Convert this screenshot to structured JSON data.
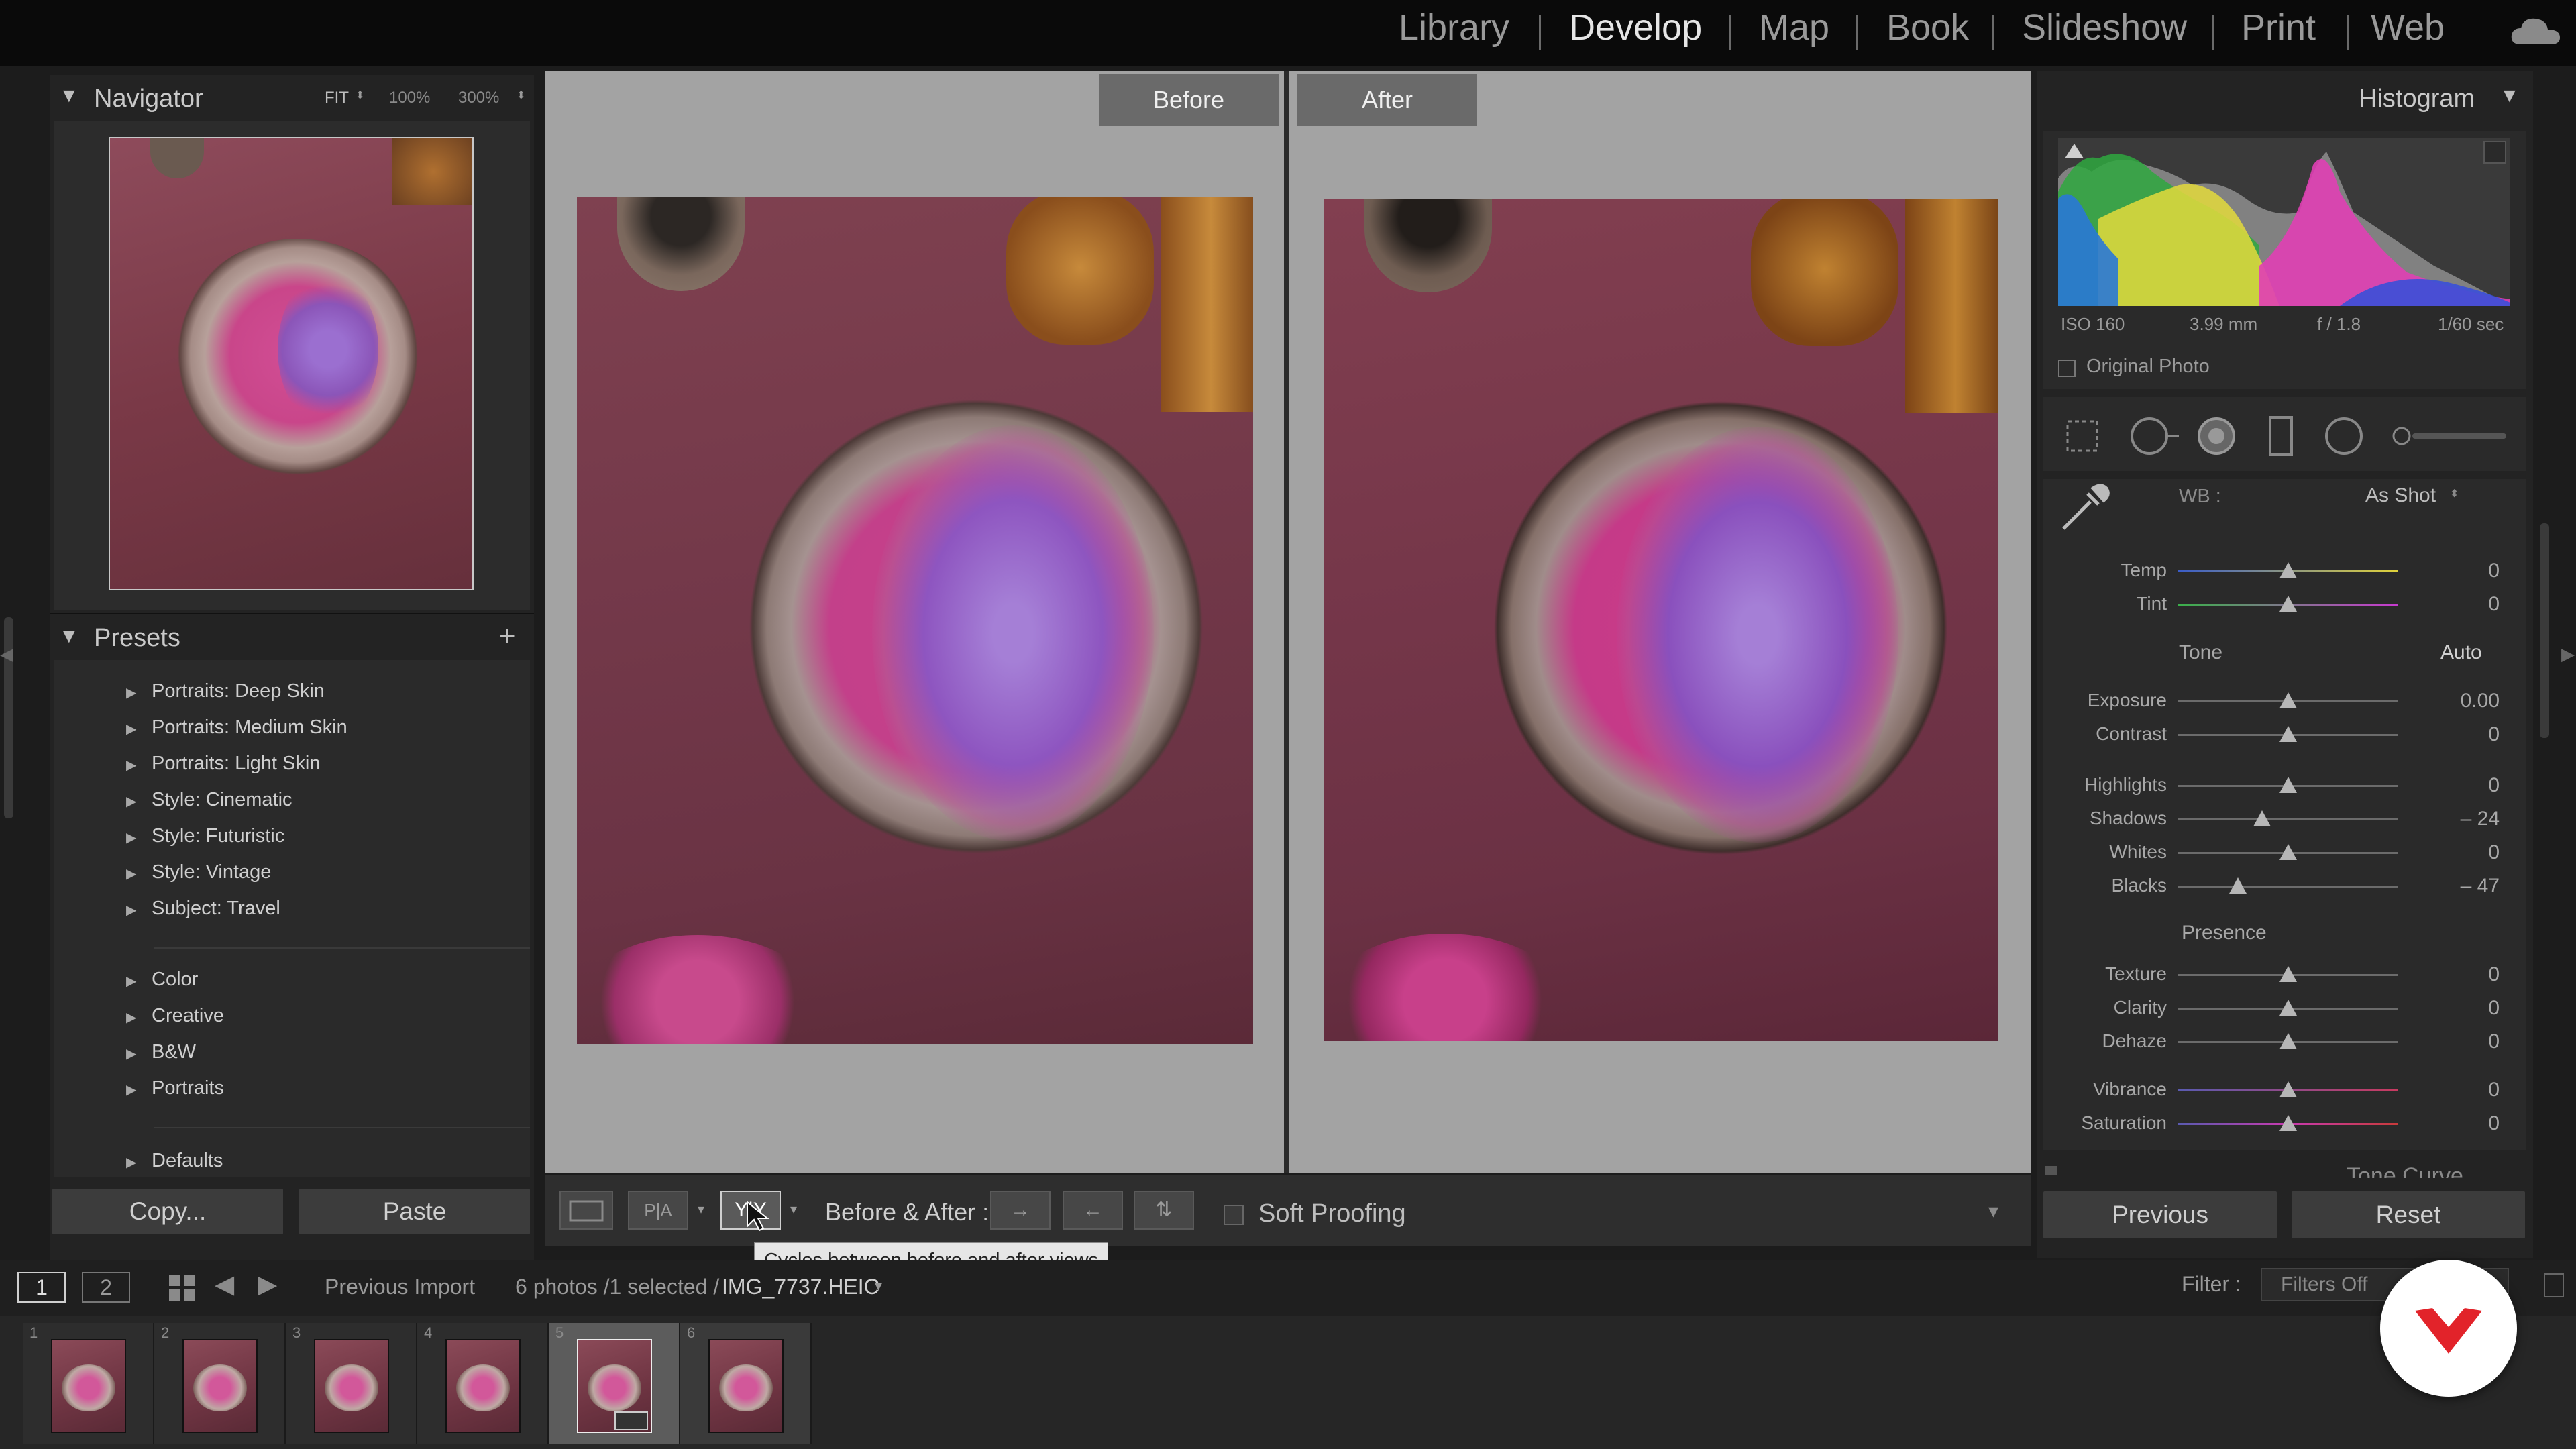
{
  "topbar": {
    "modules": [
      "Library",
      "Develop",
      "Map",
      "Book",
      "Slideshow",
      "Print",
      "Web"
    ],
    "active": "Develop",
    "cloud_icon": "cloud-icon"
  },
  "navigator": {
    "title": "Navigator",
    "zoom_fit": "FIT",
    "zoom_100": "100%",
    "zoom_300": "300%"
  },
  "presets": {
    "title": "Presets",
    "add": "+",
    "group1": [
      "Portraits: Deep Skin",
      "Portraits: Medium Skin",
      "Portraits: Light Skin",
      "Style: Cinematic",
      "Style: Futuristic",
      "Style: Vintage",
      "Subject: Travel"
    ],
    "group2": [
      "Color",
      "Creative",
      "B&W",
      "Portraits"
    ],
    "group3": [
      "Defaults"
    ]
  },
  "left_buttons": {
    "copy": "Copy...",
    "paste": "Paste"
  },
  "compare": {
    "before": "Before",
    "after": "After"
  },
  "toolbar": {
    "yy_icon": "before-after-left-right-icon",
    "before_after_label": "Before & After :",
    "soft_proofing": "Soft Proofing",
    "tooltip": "Cycles between before and after views"
  },
  "histogram": {
    "title": "Histogram",
    "iso": "ISO 160",
    "focal": "3.99 mm",
    "aperture": "f / 1.8",
    "shutter": "1/60 sec",
    "original_photo": "Original Photo"
  },
  "basic": {
    "wb_label": "WB :",
    "wb_value": "As Shot",
    "tone_label": "Tone",
    "auto_label": "Auto",
    "presence_label": "Presence",
    "sliders": [
      {
        "label": "Temp",
        "value": "0",
        "pos": 0.5
      },
      {
        "label": "Tint",
        "value": "0",
        "pos": 0.5
      },
      {
        "label": "Exposure",
        "value": "0.00",
        "pos": 0.5
      },
      {
        "label": "Contrast",
        "value": "0",
        "pos": 0.5
      },
      {
        "label": "Highlights",
        "value": "0",
        "pos": 0.5
      },
      {
        "label": "Shadows",
        "value": "– 24",
        "pos": 0.38
      },
      {
        "label": "Whites",
        "value": "0",
        "pos": 0.5
      },
      {
        "label": "Blacks",
        "value": "– 47",
        "pos": 0.27
      },
      {
        "label": "Texture",
        "value": "0",
        "pos": 0.5
      },
      {
        "label": "Clarity",
        "value": "0",
        "pos": 0.5
      },
      {
        "label": "Dehaze",
        "value": "0",
        "pos": 0.5
      },
      {
        "label": "Vibrance",
        "value": "0",
        "pos": 0.5
      },
      {
        "label": "Saturation",
        "value": "0",
        "pos": 0.5
      }
    ],
    "next_panel": "Tone Curve"
  },
  "right_buttons": {
    "previous": "Previous",
    "reset": "Reset"
  },
  "filmstrip_bar": {
    "screen1": "1",
    "screen2": "2",
    "source": "Previous Import",
    "count": "6 photos /1 selected /",
    "filename": "IMG_7737.HEIC",
    "filter_label": "Filter :",
    "filter_value": "Filters Off"
  },
  "filmstrip": {
    "numbers": [
      "1",
      "2",
      "3",
      "4",
      "5",
      "6"
    ],
    "selected_index": 5
  }
}
